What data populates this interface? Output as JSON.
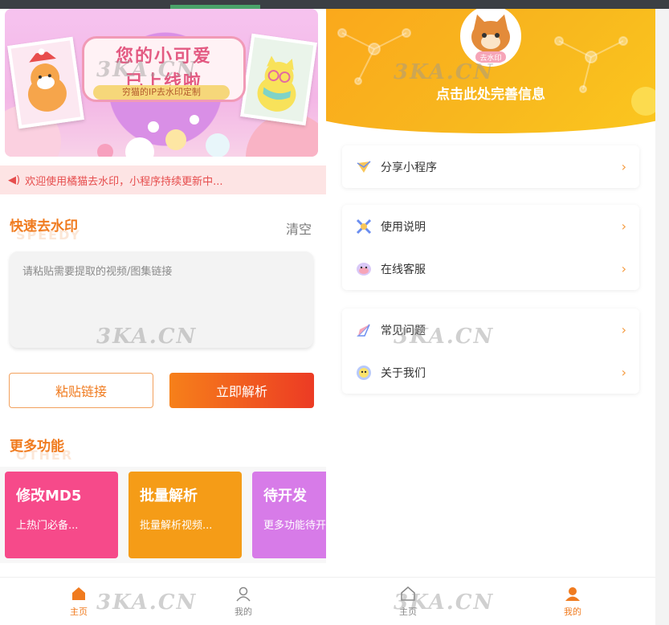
{
  "banner": {
    "line1": "您的小可爱",
    "line2": "已上线啦",
    "tag": "穷猫的IP去水印定制",
    "cat_badge": "去水印"
  },
  "notice": {
    "text": "欢迎使用橘猫去水印，小程序持续更新中..."
  },
  "quick": {
    "title": "快速去水印",
    "subtitle": "SPEEDY",
    "clear": "清空",
    "placeholder": "请粘贴需要提取的视频/图集链接",
    "paste_button": "粘贴链接",
    "parse_button": "立即解析"
  },
  "more": {
    "title": "更多功能",
    "subtitle": "OTHER",
    "items": [
      {
        "title": "修改MD5",
        "desc": "上热门必备...",
        "color": "#f64a8a"
      },
      {
        "title": "批量解析",
        "desc": "批量解析视频...",
        "color": "#f59c17"
      },
      {
        "title": "待开发",
        "desc": "更多功能待开发",
        "color": "#d77be8"
      }
    ]
  },
  "tabs_left": [
    {
      "label": "主页",
      "active": true
    },
    {
      "label": "我的",
      "active": false
    }
  ],
  "tabs_right": [
    {
      "label": "主页",
      "active": false
    },
    {
      "label": "我的",
      "active": true
    }
  ],
  "profile": {
    "avatar_badge": "去水印",
    "title": "点击此处完善信息",
    "cards": [
      [
        {
          "label": "分享小程序",
          "icon": "share-plane-icon"
        }
      ],
      [
        {
          "label": "使用说明",
          "icon": "instructions-icon"
        },
        {
          "label": "在线客服",
          "icon": "customer-service-icon"
        }
      ],
      [
        {
          "label": "常见问题",
          "icon": "faq-icon"
        },
        {
          "label": "关于我们",
          "icon": "about-icon"
        }
      ]
    ],
    "chevron": "›"
  },
  "watermark": "3KA.CN",
  "colors": {
    "orange": "#f07b1f",
    "active_tab": "#f07b1f",
    "inactive_tab": "#888888"
  }
}
